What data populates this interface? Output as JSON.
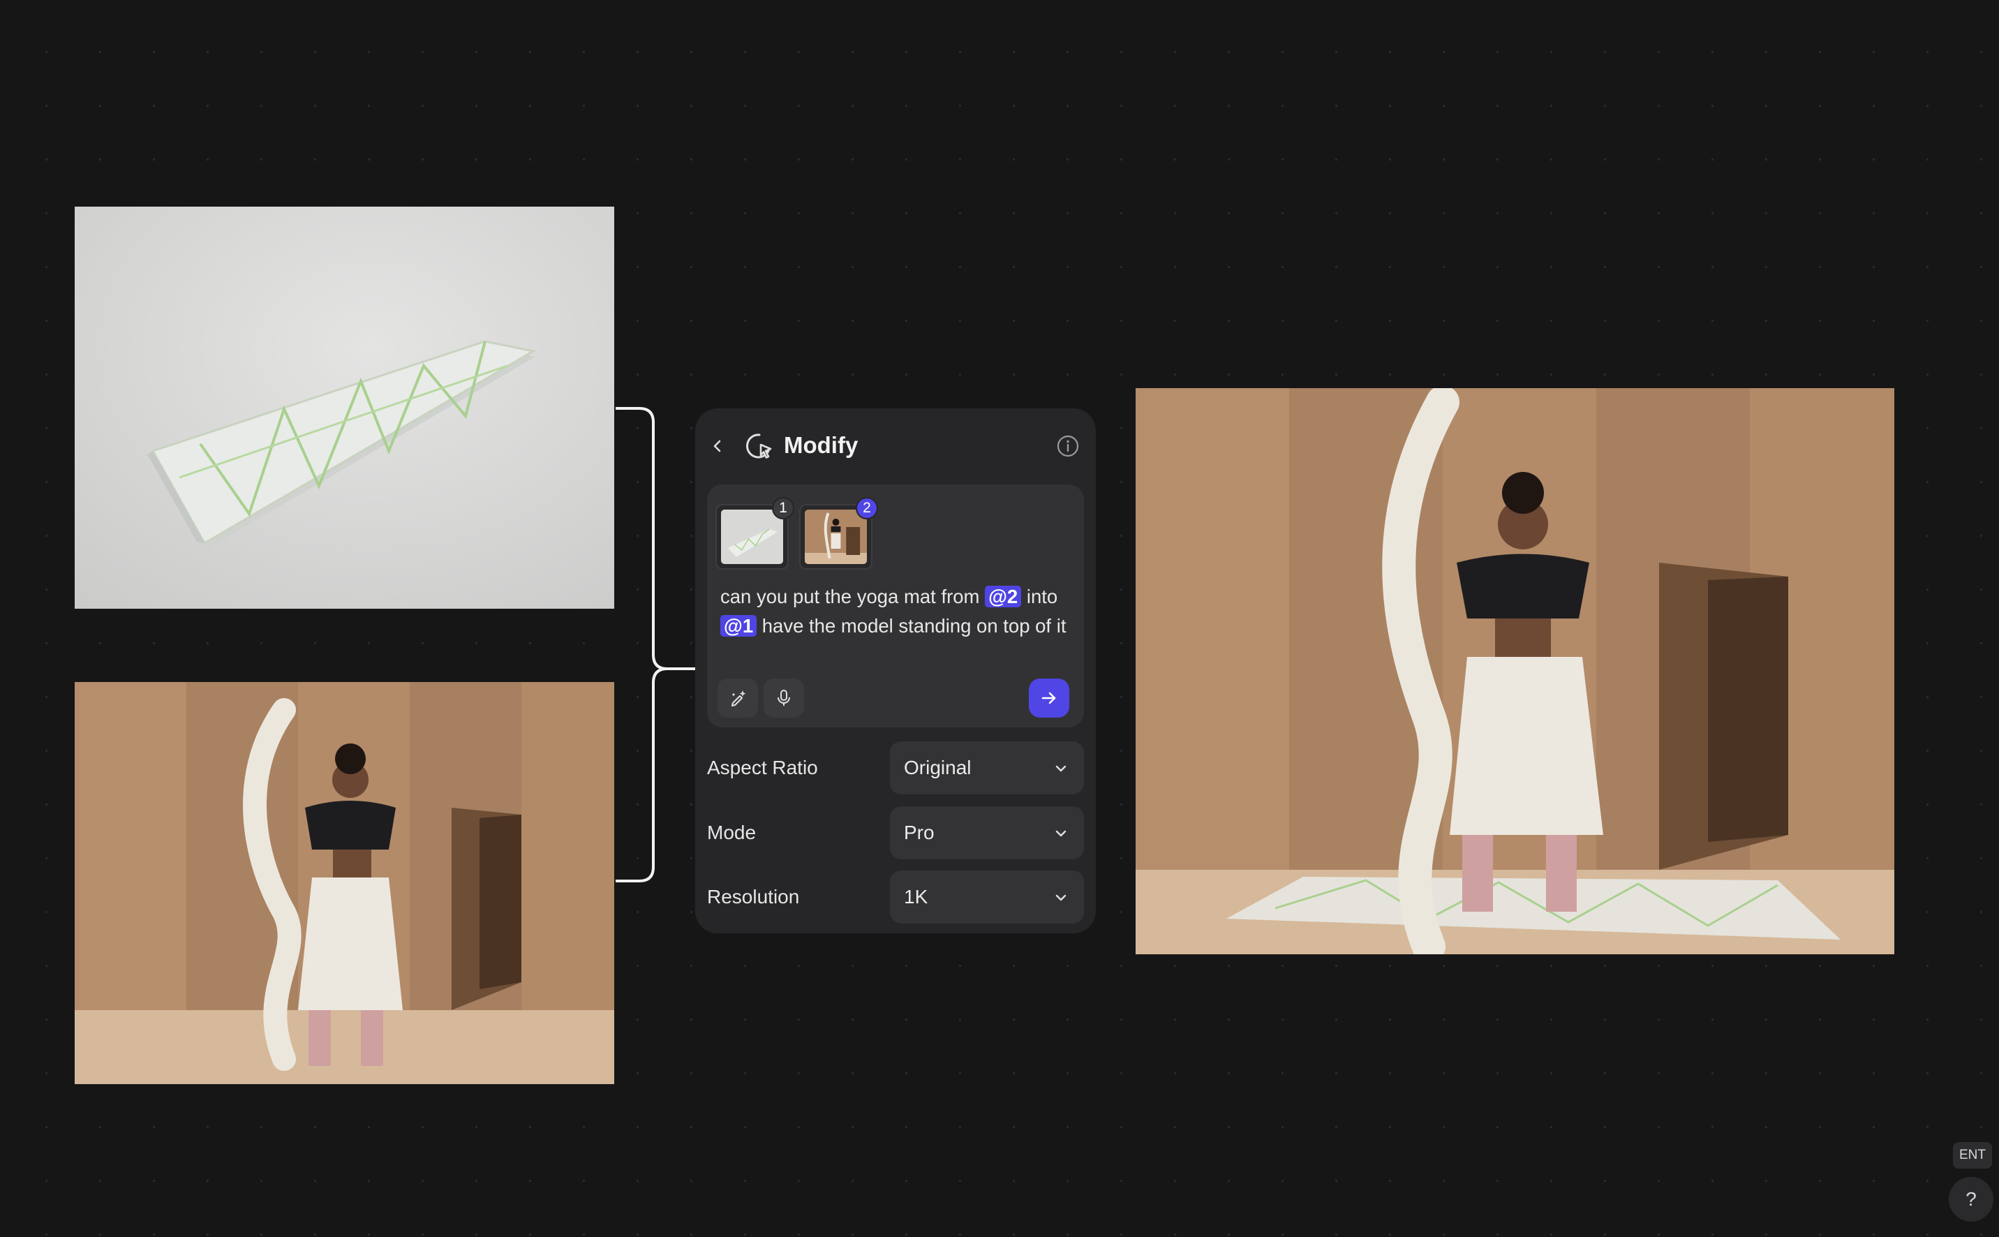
{
  "panel": {
    "title": "Modify",
    "back_icon": "chevron-left-icon",
    "tool_icon": "modify-cursor-icon",
    "info_icon": "info-icon"
  },
  "references": [
    {
      "index": "1",
      "image": "yoga-mat-photo"
    },
    {
      "index": "2",
      "image": "model-photo"
    }
  ],
  "prompt": {
    "part1": "can you put the yoga mat from ",
    "mention1": "@2",
    "part2": " into ",
    "mention2": "@1",
    "part3": " have the model standing on top of it"
  },
  "tools": {
    "enhance_icon": "sparkle-pen-icon",
    "mic_icon": "microphone-icon",
    "send_icon": "arrow-right-icon"
  },
  "settings": [
    {
      "label": "Aspect Ratio",
      "value": "Original"
    },
    {
      "label": "Mode",
      "value": "Pro"
    },
    {
      "label": "Resolution",
      "value": "1K"
    }
  ],
  "corner": {
    "ent_label": "ENT",
    "help_label": "?"
  },
  "colors": {
    "canvas_bg": "#161617",
    "panel_bg": "#262628",
    "accent": "#5046e5"
  }
}
